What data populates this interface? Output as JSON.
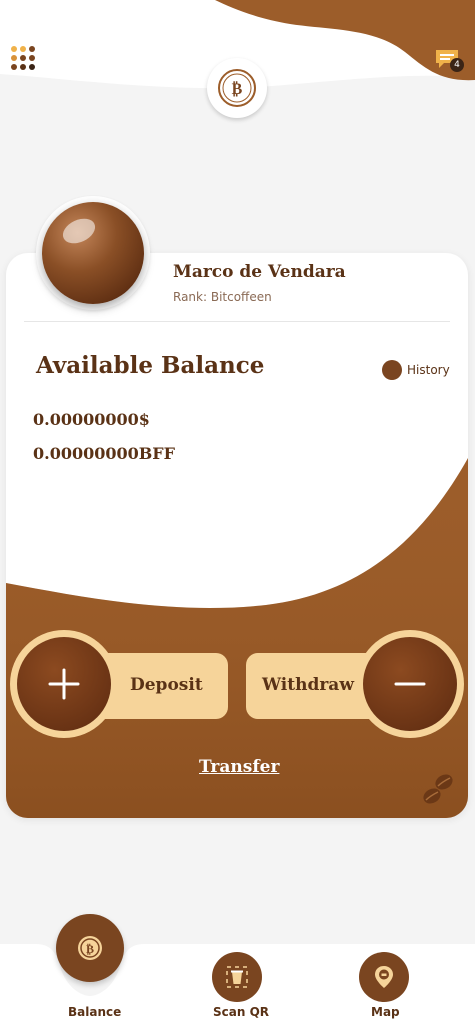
{
  "header": {
    "menu_icon": "grid-dots-icon",
    "chat_icon": "chat-bubble-icon",
    "chat_badge": "4",
    "logo_icon": "bitcoffeen-logo-icon"
  },
  "profile": {
    "name": "Marco de Vendara",
    "rank": "Rank: Bitcoffeen"
  },
  "balance": {
    "title": "Available Balance",
    "history_label": "History",
    "usd": "0.00000000$",
    "bff": "0.00000000BFF"
  },
  "actions": {
    "deposit_label": "Deposit",
    "withdraw_label": "Withdraw",
    "transfer_label": "Transfer"
  },
  "nav": {
    "items": [
      {
        "label": "Balance",
        "icon": "balance-coin-icon"
      },
      {
        "label": "Scan QR",
        "icon": "coffee-cup-icon"
      },
      {
        "label": "Map",
        "icon": "map-pin-icon"
      }
    ]
  },
  "colors": {
    "brown": "#7a4520",
    "dark_brown": "#5a3216",
    "cream": "#f6d49a"
  }
}
